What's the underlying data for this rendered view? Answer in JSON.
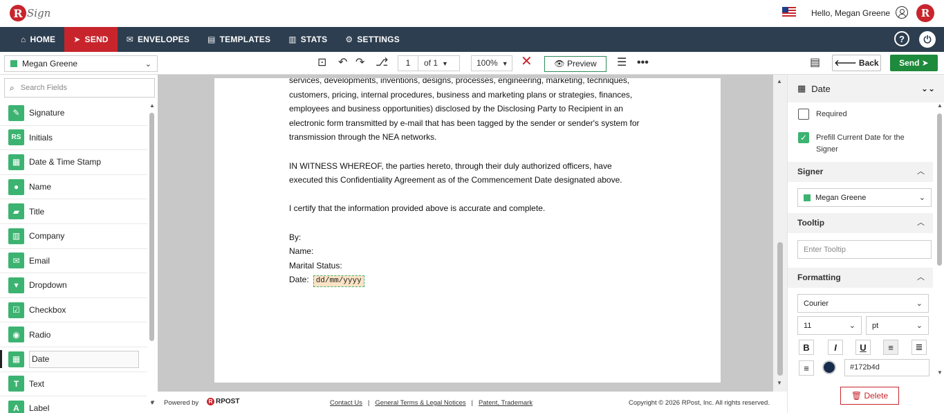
{
  "header": {
    "logo_letter": "R",
    "logo_text": "Sign",
    "greeting": "Hello, Megan Greene",
    "brand_letter": "R"
  },
  "nav": {
    "items": [
      {
        "label": "HOME",
        "icon": "home-icon"
      },
      {
        "label": "SEND",
        "icon": "send-icon",
        "active": true
      },
      {
        "label": "ENVELOPES",
        "icon": "envelope-icon"
      },
      {
        "label": "TEMPLATES",
        "icon": "template-icon"
      },
      {
        "label": "STATS",
        "icon": "stats-icon"
      },
      {
        "label": "SETTINGS",
        "icon": "gear-icon"
      }
    ],
    "help": "?",
    "power": "⏻"
  },
  "toolbar": {
    "signer": "Megan Greene",
    "page_current": "1",
    "page_of": "of  1",
    "zoom": "100%",
    "preview_label": "Preview",
    "back_label": "Back",
    "send_label": "Send"
  },
  "left": {
    "search_placeholder": "Search Fields",
    "fields": [
      {
        "label": "Signature",
        "icon": "signature-icon",
        "glyph": "✎"
      },
      {
        "label": "Initials",
        "icon": "initials-icon",
        "glyph": "RS"
      },
      {
        "label": "Date & Time Stamp",
        "icon": "datetime-icon",
        "glyph": "▦"
      },
      {
        "label": "Name",
        "icon": "person-icon",
        "glyph": "●"
      },
      {
        "label": "Title",
        "icon": "briefcase-icon",
        "glyph": "▰"
      },
      {
        "label": "Company",
        "icon": "building-icon",
        "glyph": "▥"
      },
      {
        "label": "Email",
        "icon": "email-icon",
        "glyph": "✉"
      },
      {
        "label": "Dropdown",
        "icon": "dropdown-icon",
        "glyph": "▾"
      },
      {
        "label": "Checkbox",
        "icon": "checkbox-icon",
        "glyph": "☑"
      },
      {
        "label": "Radio",
        "icon": "radio-icon",
        "glyph": "◉"
      },
      {
        "label": "Date",
        "icon": "calendar-icon",
        "glyph": "▦",
        "selected": true
      },
      {
        "label": "Text",
        "icon": "text-icon",
        "glyph": "T"
      },
      {
        "label": "Label",
        "icon": "label-icon",
        "glyph": "A"
      }
    ]
  },
  "document": {
    "lines_p1": [
      "services, developments, inventions, designs, processes, engineering, marketing, techniques,",
      "customers, pricing, internal procedures, business and marketing plans or strategies, finances,",
      "employees and business opportunities) disclosed by the Disclosing Party to Recipient in an",
      "electronic form transmitted by e-mail that has been tagged by the sender or sender's system for",
      "transmission through the NEA networks."
    ],
    "lines_p2": [
      "IN WITNESS WHEREOF, the parties hereto, through their duly authorized officers, have",
      "executed this Confidentiality Agreement as of the Commencement Date designated above."
    ],
    "certify": "I certify that the information provided above is accurate and complete.",
    "by": "By:",
    "name": "Name:",
    "marital": "Marital Status:",
    "date_label": "Date:",
    "date_field": "dd/mm/yyyy"
  },
  "footer": {
    "powered": "Powered by",
    "rpost": "RPOST",
    "contact": "Contact Us",
    "terms": "General Terms & Legal Notices",
    "patent": "Patent, Trademark",
    "copyright": "Copyright © 2026 RPost, Inc. All rights reserved."
  },
  "right": {
    "title": "Date",
    "required_label": "Required",
    "prefill_label": "Prefill Current Date for the Signer",
    "signer_section": "Signer",
    "signer_value": "Megan Greene",
    "tooltip_section": "Tooltip",
    "tooltip_placeholder": "Enter Tooltip",
    "formatting_section": "Formatting",
    "font": "Courier",
    "font_size": "11",
    "font_unit": "pt",
    "bold": "B",
    "italic": "I",
    "underline": "U",
    "color_hex": "#172b4d",
    "delete_label": "Delete"
  },
  "colors": {
    "brand_red": "#c8242c",
    "nav_bg": "#2d3e50",
    "field_green": "#3cb371",
    "send_green": "#1e8a3c",
    "text_color": "#172b4d"
  }
}
